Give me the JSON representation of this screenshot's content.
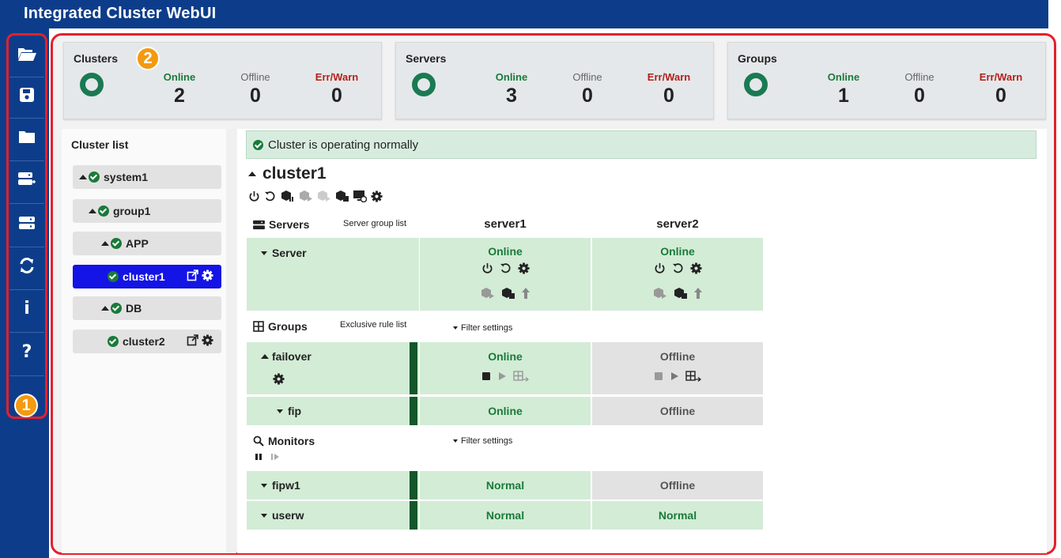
{
  "app": {
    "title": "Integrated Cluster WebUI"
  },
  "sidebar": {
    "items": [
      {
        "icon": "folder-open-icon"
      },
      {
        "icon": "save-icon"
      },
      {
        "icon": "folder-icon"
      },
      {
        "icon": "server-add-icon"
      },
      {
        "icon": "server-icon"
      },
      {
        "icon": "refresh-icon"
      },
      {
        "icon": "info-icon",
        "glyph": "i"
      },
      {
        "icon": "help-icon",
        "glyph": "?"
      }
    ]
  },
  "badges": {
    "one": "1",
    "two": "2"
  },
  "summary": {
    "clusters": {
      "title": "Clusters",
      "online_label": "Online",
      "offline_label": "Offline",
      "err_label": "Err/Warn",
      "online": "2",
      "offline": "0",
      "err": "0"
    },
    "servers": {
      "title": "Servers",
      "online_label": "Online",
      "offline_label": "Offline",
      "err_label": "Err/Warn",
      "online": "3",
      "offline": "0",
      "err": "0"
    },
    "groups": {
      "title": "Groups",
      "online_label": "Online",
      "offline_label": "Offline",
      "err_label": "Err/Warn",
      "online": "1",
      "offline": "0",
      "err": "0"
    }
  },
  "tree": {
    "title": "Cluster list",
    "nodes": [
      "system1",
      "group1",
      "APP",
      "cluster1",
      "DB",
      "cluster2"
    ]
  },
  "content": {
    "alert": "Cluster is operating normally",
    "cluster_name": "cluster1",
    "servers_section": {
      "title": "Servers",
      "link": "Server group list"
    },
    "servers": [
      "server1",
      "server2"
    ],
    "server_row": {
      "name": "Server",
      "status": [
        "Online",
        "Online"
      ]
    },
    "groups_section": {
      "title": "Groups",
      "link": "Exclusive rule list",
      "filter": "Filter settings"
    },
    "failover": {
      "name": "failover",
      "status": [
        "Online",
        "Offline"
      ]
    },
    "fip": {
      "name": "fip",
      "status": [
        "Online",
        "Offline"
      ]
    },
    "monitors_section": {
      "title": "Monitors",
      "filter": "Filter settings"
    },
    "fipw1": {
      "name": "fipw1",
      "status": [
        "Normal",
        "Offline"
      ]
    },
    "userw": {
      "name": "userw",
      "status": [
        "Normal",
        "Normal"
      ]
    }
  },
  "colors": {
    "nav": "#0d3d8a",
    "online": "#1a7a3a",
    "err": "#b3201a",
    "selected": "#1414e6",
    "green_cell": "#d3ecd6",
    "gray_cell": "#e2e2e2",
    "alert_bg": "#d7ecdf",
    "highlight": "#e4202d",
    "badge": "#f39a11"
  }
}
